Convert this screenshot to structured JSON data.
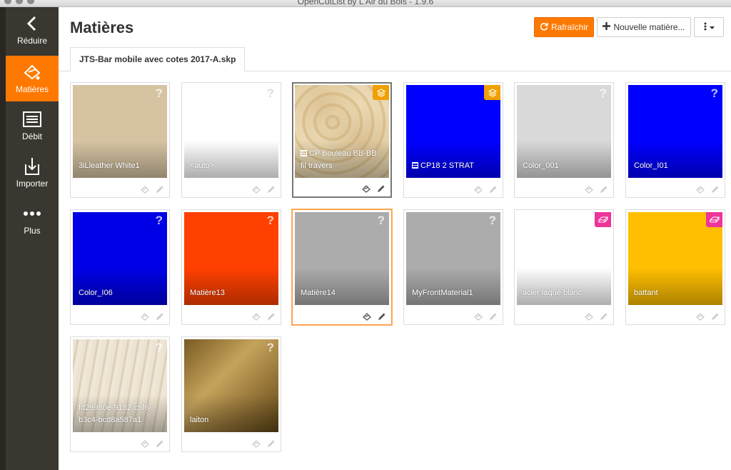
{
  "window": {
    "title": "OpenCutList by L'Air du Bois - 1.9.6"
  },
  "sidebar": {
    "items": [
      {
        "label": "Réduire",
        "icon": "chevron-left-icon",
        "active": false
      },
      {
        "label": "Matières",
        "icon": "materials-icon",
        "active": true
      },
      {
        "label": "Débit",
        "icon": "list-icon",
        "active": false
      },
      {
        "label": "Importer",
        "icon": "import-icon",
        "active": false
      },
      {
        "label": "Plus",
        "icon": "more-dots-icon",
        "active": false
      }
    ]
  },
  "header": {
    "title": "Matières",
    "refresh_label": "Rafraîchir",
    "new_material_label": "Nouvelle matière...",
    "accent": "#ff7900"
  },
  "tabs": [
    {
      "label": "JTS-Bar mobile avec cotes 2017-A.skp",
      "active": true
    }
  ],
  "materials": [
    {
      "name": "3iLleather White1",
      "color": "#d6c3a2",
      "type": "unknown"
    },
    {
      "name": "<auto>",
      "color": "#ffffff",
      "type": "unknown"
    },
    {
      "name": "CP Bouleau BB-BB fil travers",
      "color": "#e6d2a8",
      "texture": "birch",
      "type": "sheet",
      "selected": true
    },
    {
      "name": "CP18 2 STRAT",
      "color": "#0000ff",
      "type": "sheet"
    },
    {
      "name": "Color_001",
      "color": "#d9d9d9",
      "type": "unknown"
    },
    {
      "name": "Color_I01",
      "color": "#0000ff",
      "type": "unknown"
    },
    {
      "name": "Color_I06",
      "color": "#0000e6",
      "type": "unknown"
    },
    {
      "name": "Matière13",
      "color": "#ff4000",
      "type": "unknown"
    },
    {
      "name": "Matière14",
      "color": "#acacac",
      "type": "unknown",
      "hover": true
    },
    {
      "name": "MyFrontMaterial1",
      "color": "#acacac",
      "type": "unknown"
    },
    {
      "name": "acier laqué blanc",
      "color": "#ffffff",
      "type": "edge"
    },
    {
      "name": "battant",
      "color": "#ffbf00",
      "type": "edge"
    },
    {
      "name": "fd29980e-9182-c5f6-b3c4-bcd8a587a1",
      "color": "#e8ddc8",
      "texture": "maple",
      "type": "unknown"
    },
    {
      "name": "laiton",
      "color": "#a8863f",
      "texture": "brass",
      "type": "unknown"
    }
  ]
}
